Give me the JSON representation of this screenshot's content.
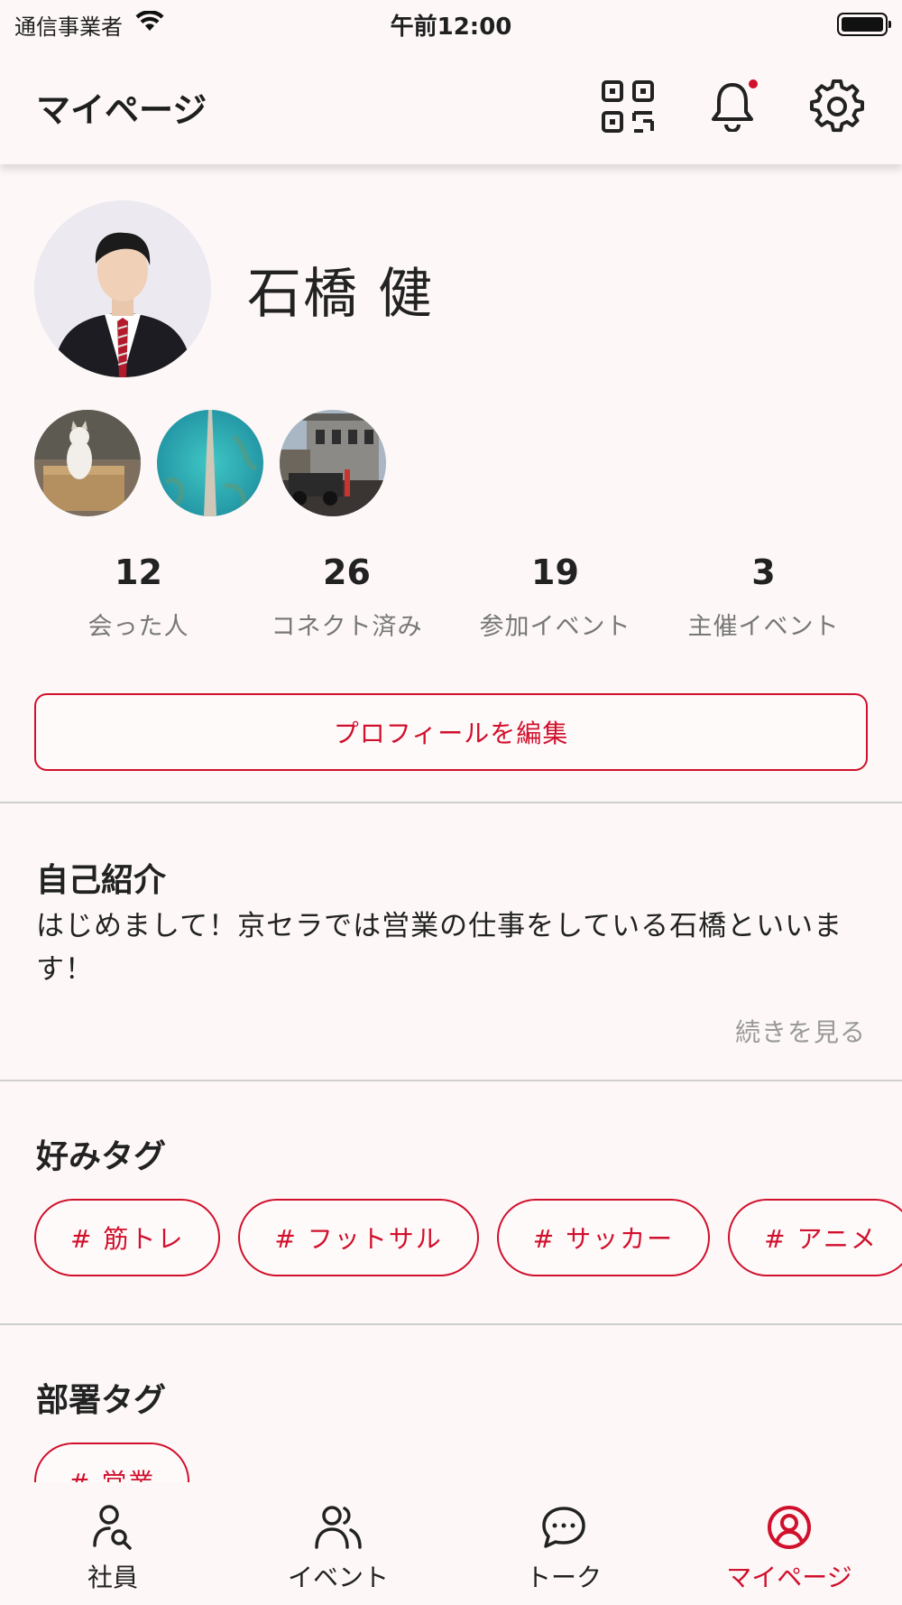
{
  "status_bar": {
    "carrier": "通信事業者",
    "time": "午前12:00"
  },
  "header": {
    "title": "マイページ"
  },
  "profile": {
    "name": "石橋 健"
  },
  "stats": [
    {
      "value": "12",
      "label": "会った人"
    },
    {
      "value": "26",
      "label": "コネクト済み"
    },
    {
      "value": "19",
      "label": "参加イベント"
    },
    {
      "value": "3",
      "label": "主催イベント"
    }
  ],
  "edit_button": "プロフィールを編集",
  "intro": {
    "title": "自己紹介",
    "text": "はじめまして！京セラでは営業の仕事をしている石橋といいます！",
    "more": "続きを見る"
  },
  "favorite_tags": {
    "title": "好みタグ",
    "items": [
      "# 筋トレ",
      "# フットサル",
      "# サッカー",
      "# アニメ",
      ""
    ]
  },
  "department_tags": {
    "title": "部署タグ",
    "items": [
      "# 営業"
    ]
  },
  "bottom_nav": [
    {
      "label": "社員",
      "icon": "employee-search-icon"
    },
    {
      "label": "イベント",
      "icon": "people-icon"
    },
    {
      "label": "トーク",
      "icon": "chat-bubble-icon"
    },
    {
      "label": "マイページ",
      "icon": "user-circle-icon",
      "active": true
    }
  ],
  "colors": {
    "accent": "#d0102c",
    "background": "#fdf8f7",
    "muted": "#777777"
  }
}
